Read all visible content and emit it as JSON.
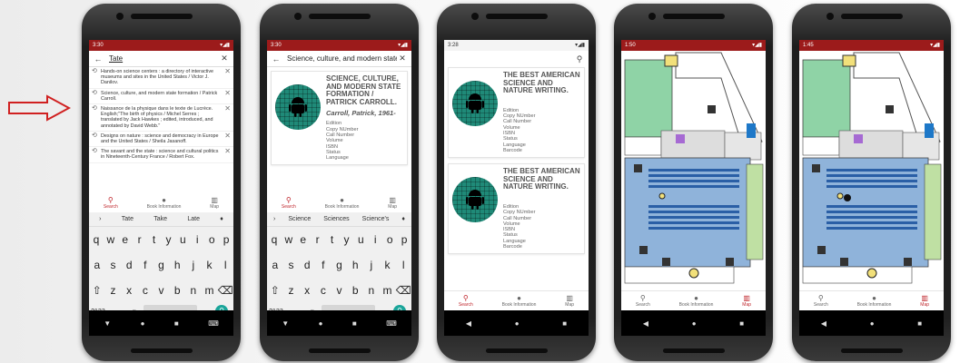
{
  "phones": [
    {
      "status_time": "3:30",
      "query": "Tate",
      "suggestions": [
        "Hands-on science centers : a directory of interactive museums and sites in the United States / Victor J. Danilov.",
        "Science, culture, and modern state formation / Patrick Carroll.",
        "Naissance de la physique dans le texte de Lucrèce. English;\"The birth of physics / Michel Serres ; translated by Jack Hawkes ; edited, introduced, and annotated by David Webb.\"",
        "Designs on nature : science and democracy in Europe and the United States / Sheila Jasanoff.",
        "The savant and the state : science and cultural politics in Nineteenth-Century France / Robert Fox."
      ],
      "kb_suggestions": [
        "Tate",
        "Take",
        "Late"
      ]
    },
    {
      "status_time": "3:30",
      "query": "Science, culture, and modern state for",
      "query_underlined": "Science",
      "book_title": "SCIENCE, CULTURE, AND MODERN STATE FORMATION / PATRICK CARROLL.",
      "book_author": "Carroll, Patrick, 1961-",
      "kb_suggestions": [
        "Science",
        "Sciences",
        "Science's"
      ]
    },
    {
      "status_time": "3:28",
      "book_title": "THE BEST AMERICAN SCIENCE AND NATURE WRITING."
    },
    {
      "status_time": "1:50"
    },
    {
      "status_time": "1:45"
    }
  ],
  "fields": [
    "Edition",
    "Copy NUmber",
    "Call Number",
    "Volume",
    "ISBN",
    "Status",
    "Language",
    "Barcode"
  ],
  "nav": {
    "search": "Search",
    "info": "Book Information",
    "map": "Map"
  },
  "keyboard": {
    "row1": [
      "q",
      "w",
      "e",
      "r",
      "t",
      "y",
      "u",
      "i",
      "o",
      "p"
    ],
    "row1_digits": [
      "1",
      "2",
      "3",
      "4",
      "5",
      "6",
      "7",
      "8",
      "9",
      "0"
    ],
    "row2": [
      "a",
      "s",
      "d",
      "f",
      "g",
      "h",
      "j",
      "k",
      "l"
    ],
    "row3": [
      "z",
      "x",
      "c",
      "v",
      "b",
      "n",
      "m"
    ],
    "mode": "?123",
    "comma": ",",
    "period": "."
  },
  "colors": {
    "accent": "#c0272d",
    "statusbar": "#9c1b1b",
    "map_green": "#8fd3a6",
    "map_blue": "#8fb3da"
  }
}
